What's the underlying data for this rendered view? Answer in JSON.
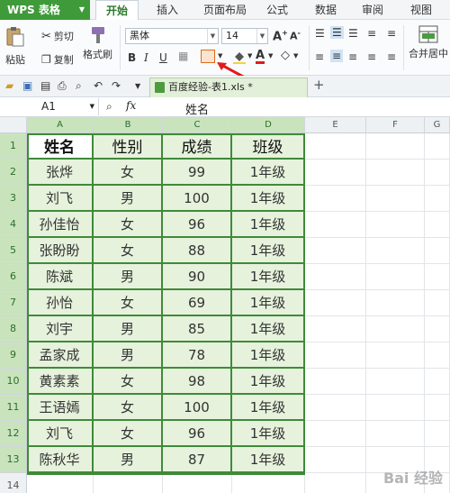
{
  "app": {
    "name": "WPS 表格"
  },
  "menu": {
    "tabs": [
      "开始",
      "插入",
      "页面布局",
      "公式",
      "数据",
      "审阅",
      "视图"
    ],
    "active": "开始"
  },
  "ribbon": {
    "paste_label": "粘贴",
    "cut_label": "剪切",
    "copy_label": "复制",
    "format_painter_label": "格式刷",
    "font_name": "黑体",
    "font_size": "14",
    "merge_label": "合并居中"
  },
  "doc_tab": {
    "title": "百度经验-表1.xls *"
  },
  "formula_bar": {
    "cell_ref": "A1",
    "fx": "fx",
    "value": "姓名"
  },
  "columns": [
    "A",
    "B",
    "C",
    "D",
    "E",
    "F",
    "G"
  ],
  "rows": [
    "1",
    "2",
    "3",
    "4",
    "5",
    "6",
    "7",
    "8",
    "9",
    "10",
    "11",
    "12",
    "13",
    "14"
  ],
  "table": {
    "headers": [
      "姓名",
      "性别",
      "成绩",
      "班级"
    ],
    "rows": [
      [
        "张烨",
        "女",
        "99",
        "1年级"
      ],
      [
        "刘飞",
        "男",
        "100",
        "1年级"
      ],
      [
        "孙佳怡",
        "女",
        "96",
        "1年级"
      ],
      [
        "张盼盼",
        "女",
        "88",
        "1年级"
      ],
      [
        "陈斌",
        "男",
        "90",
        "1年级"
      ],
      [
        "孙怡",
        "女",
        "69",
        "1年级"
      ],
      [
        "刘宇",
        "男",
        "85",
        "1年级"
      ],
      [
        "孟家成",
        "男",
        "78",
        "1年级"
      ],
      [
        "黄素素",
        "女",
        "98",
        "1年级"
      ],
      [
        "王语嫣",
        "女",
        "100",
        "1年级"
      ],
      [
        "刘飞",
        "女",
        "96",
        "1年级"
      ],
      [
        "陈秋华",
        "男",
        "87",
        "1年级"
      ]
    ]
  },
  "watermark": "Bai 经验",
  "colors": {
    "accent": "#3f9a3a",
    "cell_fill": "#e6f2dc",
    "border": "#3f8a3a"
  }
}
